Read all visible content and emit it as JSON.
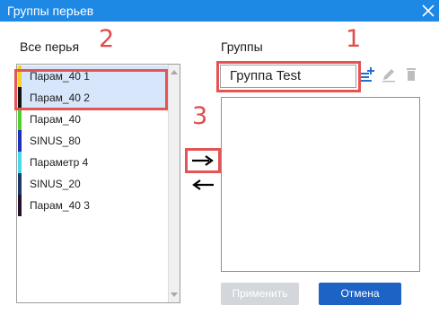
{
  "window": {
    "title": "Группы перьев"
  },
  "pens": {
    "label": "Все перья",
    "items": [
      {
        "label": "Парам_40 1",
        "color": "#f2d22b",
        "selected": true
      },
      {
        "label": "Парам_40 2",
        "color": "#111111",
        "selected": true
      },
      {
        "label": "Парам_40",
        "color": "#4fd12a",
        "selected": false
      },
      {
        "label": "SINUS_80",
        "color": "#1f2fb8",
        "selected": false
      },
      {
        "label": "Параметр 4",
        "color": "#48d9ea",
        "selected": false
      },
      {
        "label": "SINUS_20",
        "color": "#1a3b6a",
        "selected": false
      },
      {
        "label": "Парам_40 3",
        "color": "#2a0f28",
        "selected": false
      }
    ]
  },
  "groups": {
    "label": "Группы",
    "current_group": "Группа Test",
    "items": []
  },
  "annotations": {
    "n1": "1",
    "n2": "2",
    "n3": "3"
  },
  "buttons": {
    "apply": "Применить",
    "cancel": "Отмена"
  },
  "colors": {
    "titlebar": "#1e88e5",
    "annotation": "#e45454",
    "cancel": "#1d63c5",
    "selection": "#d7e6fb"
  },
  "icons": [
    "close-icon",
    "arrow-right-icon",
    "arrow-left-icon",
    "add-group-icon",
    "edit-icon",
    "delete-icon"
  ]
}
